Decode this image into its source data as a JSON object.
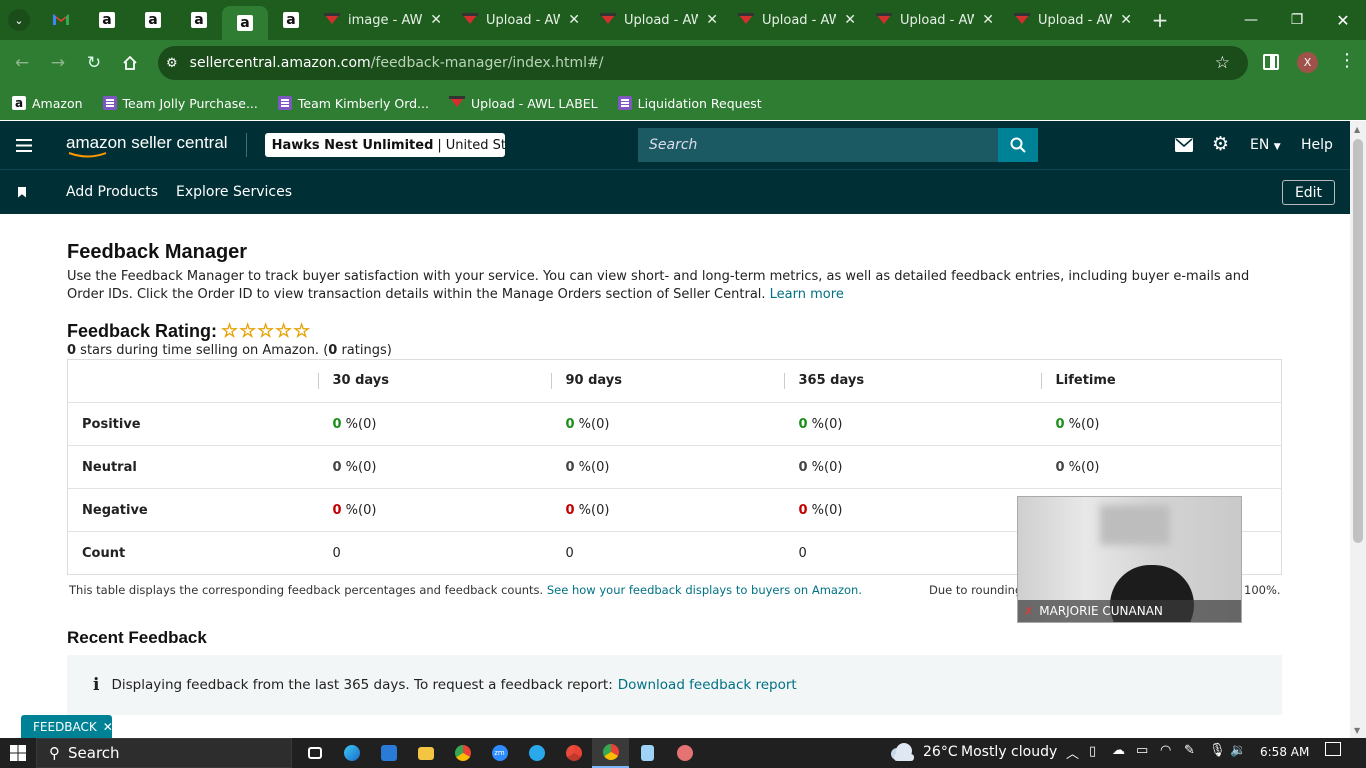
{
  "browser": {
    "tabs": [
      {
        "kind": "gmail"
      },
      {
        "kind": "amazon"
      },
      {
        "kind": "amazon"
      },
      {
        "kind": "amazon"
      },
      {
        "kind": "amazon",
        "active": true
      },
      {
        "kind": "amazon"
      },
      {
        "kind": "awl",
        "label": "image - AWL"
      },
      {
        "kind": "awl",
        "label": "Upload - AW"
      },
      {
        "kind": "awl",
        "label": "Upload - AW"
      },
      {
        "kind": "awl",
        "label": "Upload - AW"
      },
      {
        "kind": "awl",
        "label": "Upload - AW"
      },
      {
        "kind": "awl",
        "label": "Upload - AW"
      }
    ],
    "url_domain": "sellercentral.amazon.com",
    "url_path": "/feedback-manager/index.html#/",
    "profile_initial": "X",
    "bookmarks": [
      {
        "label": "Amazon",
        "icon": "amazon-icon"
      },
      {
        "label": "Team Jolly Purchase...",
        "icon": "list-icon"
      },
      {
        "label": "Team Kimberly Ord...",
        "icon": "list-icon"
      },
      {
        "label": "Upload - AWL LABEL",
        "icon": "awl-icon"
      },
      {
        "label": "Liquidation Request",
        "icon": "list-icon"
      }
    ]
  },
  "header": {
    "logo_text": "amazon seller central",
    "store_name": "Hawks Nest Unlimited",
    "store_region": "United Sta...",
    "search_placeholder": "Search",
    "lang": "EN",
    "help": "Help"
  },
  "subnav": {
    "links": [
      "Add Products",
      "Explore Services"
    ],
    "edit": "Edit"
  },
  "page": {
    "title": "Feedback Manager",
    "description": "Use the Feedback Manager to track buyer satisfaction with your service. You can view short- and long-term metrics, as well as detailed feedback entries, including buyer e-mails and Order IDs. Click the Order ID to view transaction details within the Manage Orders section of Seller Central.",
    "learn_more": "Learn more",
    "rating_title": "Feedback Rating:",
    "rating_stars": "☆☆☆☆☆",
    "rating_count_stars": "0",
    "rating_sub_text": " stars during time selling on Amazon. (",
    "rating_count_ratings": "0",
    "rating_sub_end": " ratings)"
  },
  "table": {
    "columns": [
      "30 days",
      "90 days",
      "365 days",
      "Lifetime"
    ],
    "rows": [
      {
        "label": "Positive",
        "cells": [
          {
            "v": "0",
            "s": " %(0)"
          },
          {
            "v": "0",
            "s": " %(0)"
          },
          {
            "v": "0",
            "s": " %(0)"
          },
          {
            "v": "0",
            "s": " %(0)"
          }
        ]
      },
      {
        "label": "Neutral",
        "cells": [
          {
            "v": "0",
            "s": " %(0)"
          },
          {
            "v": "0",
            "s": " %(0)"
          },
          {
            "v": "0",
            "s": " %(0)"
          },
          {
            "v": "0",
            "s": " %(0)"
          }
        ]
      },
      {
        "label": "Negative",
        "cells": [
          {
            "v": "0",
            "s": " %(0)"
          },
          {
            "v": "0",
            "s": " %(0)"
          },
          {
            "v": "0",
            "s": " %(0)"
          },
          {
            "v": "",
            "s": ""
          }
        ]
      },
      {
        "label": "Count",
        "cells": [
          {
            "v": "0",
            "s": ""
          },
          {
            "v": "0",
            "s": ""
          },
          {
            "v": "0",
            "s": ""
          },
          {
            "v": "",
            "s": ""
          }
        ]
      }
    ],
    "footnote": "This table displays the corresponding feedback percentages and feedback counts.",
    "footnote_link": "See how your feedback displays to buyers on Amazon.",
    "footnote_right": "Due to rounding",
    "footnote_right_end": "100%."
  },
  "recent": {
    "title": "Recent Feedback",
    "info": "Displaying feedback from the last 365 days. To request a feedback report:",
    "info_link": "Download feedback report"
  },
  "video": {
    "name": "MARJORIE CUNANAN"
  },
  "feedback_tab": "FEEDBACK",
  "taskbar": {
    "search": "Search",
    "weather_temp": "26°C",
    "weather_text": "Mostly cloudy",
    "time": "6:58 AM"
  },
  "colors": {
    "accent": "#002f36",
    "link": "#007185",
    "positive": "#1a8f1a",
    "negative": "#c40000",
    "browser": "#2e7d32"
  }
}
